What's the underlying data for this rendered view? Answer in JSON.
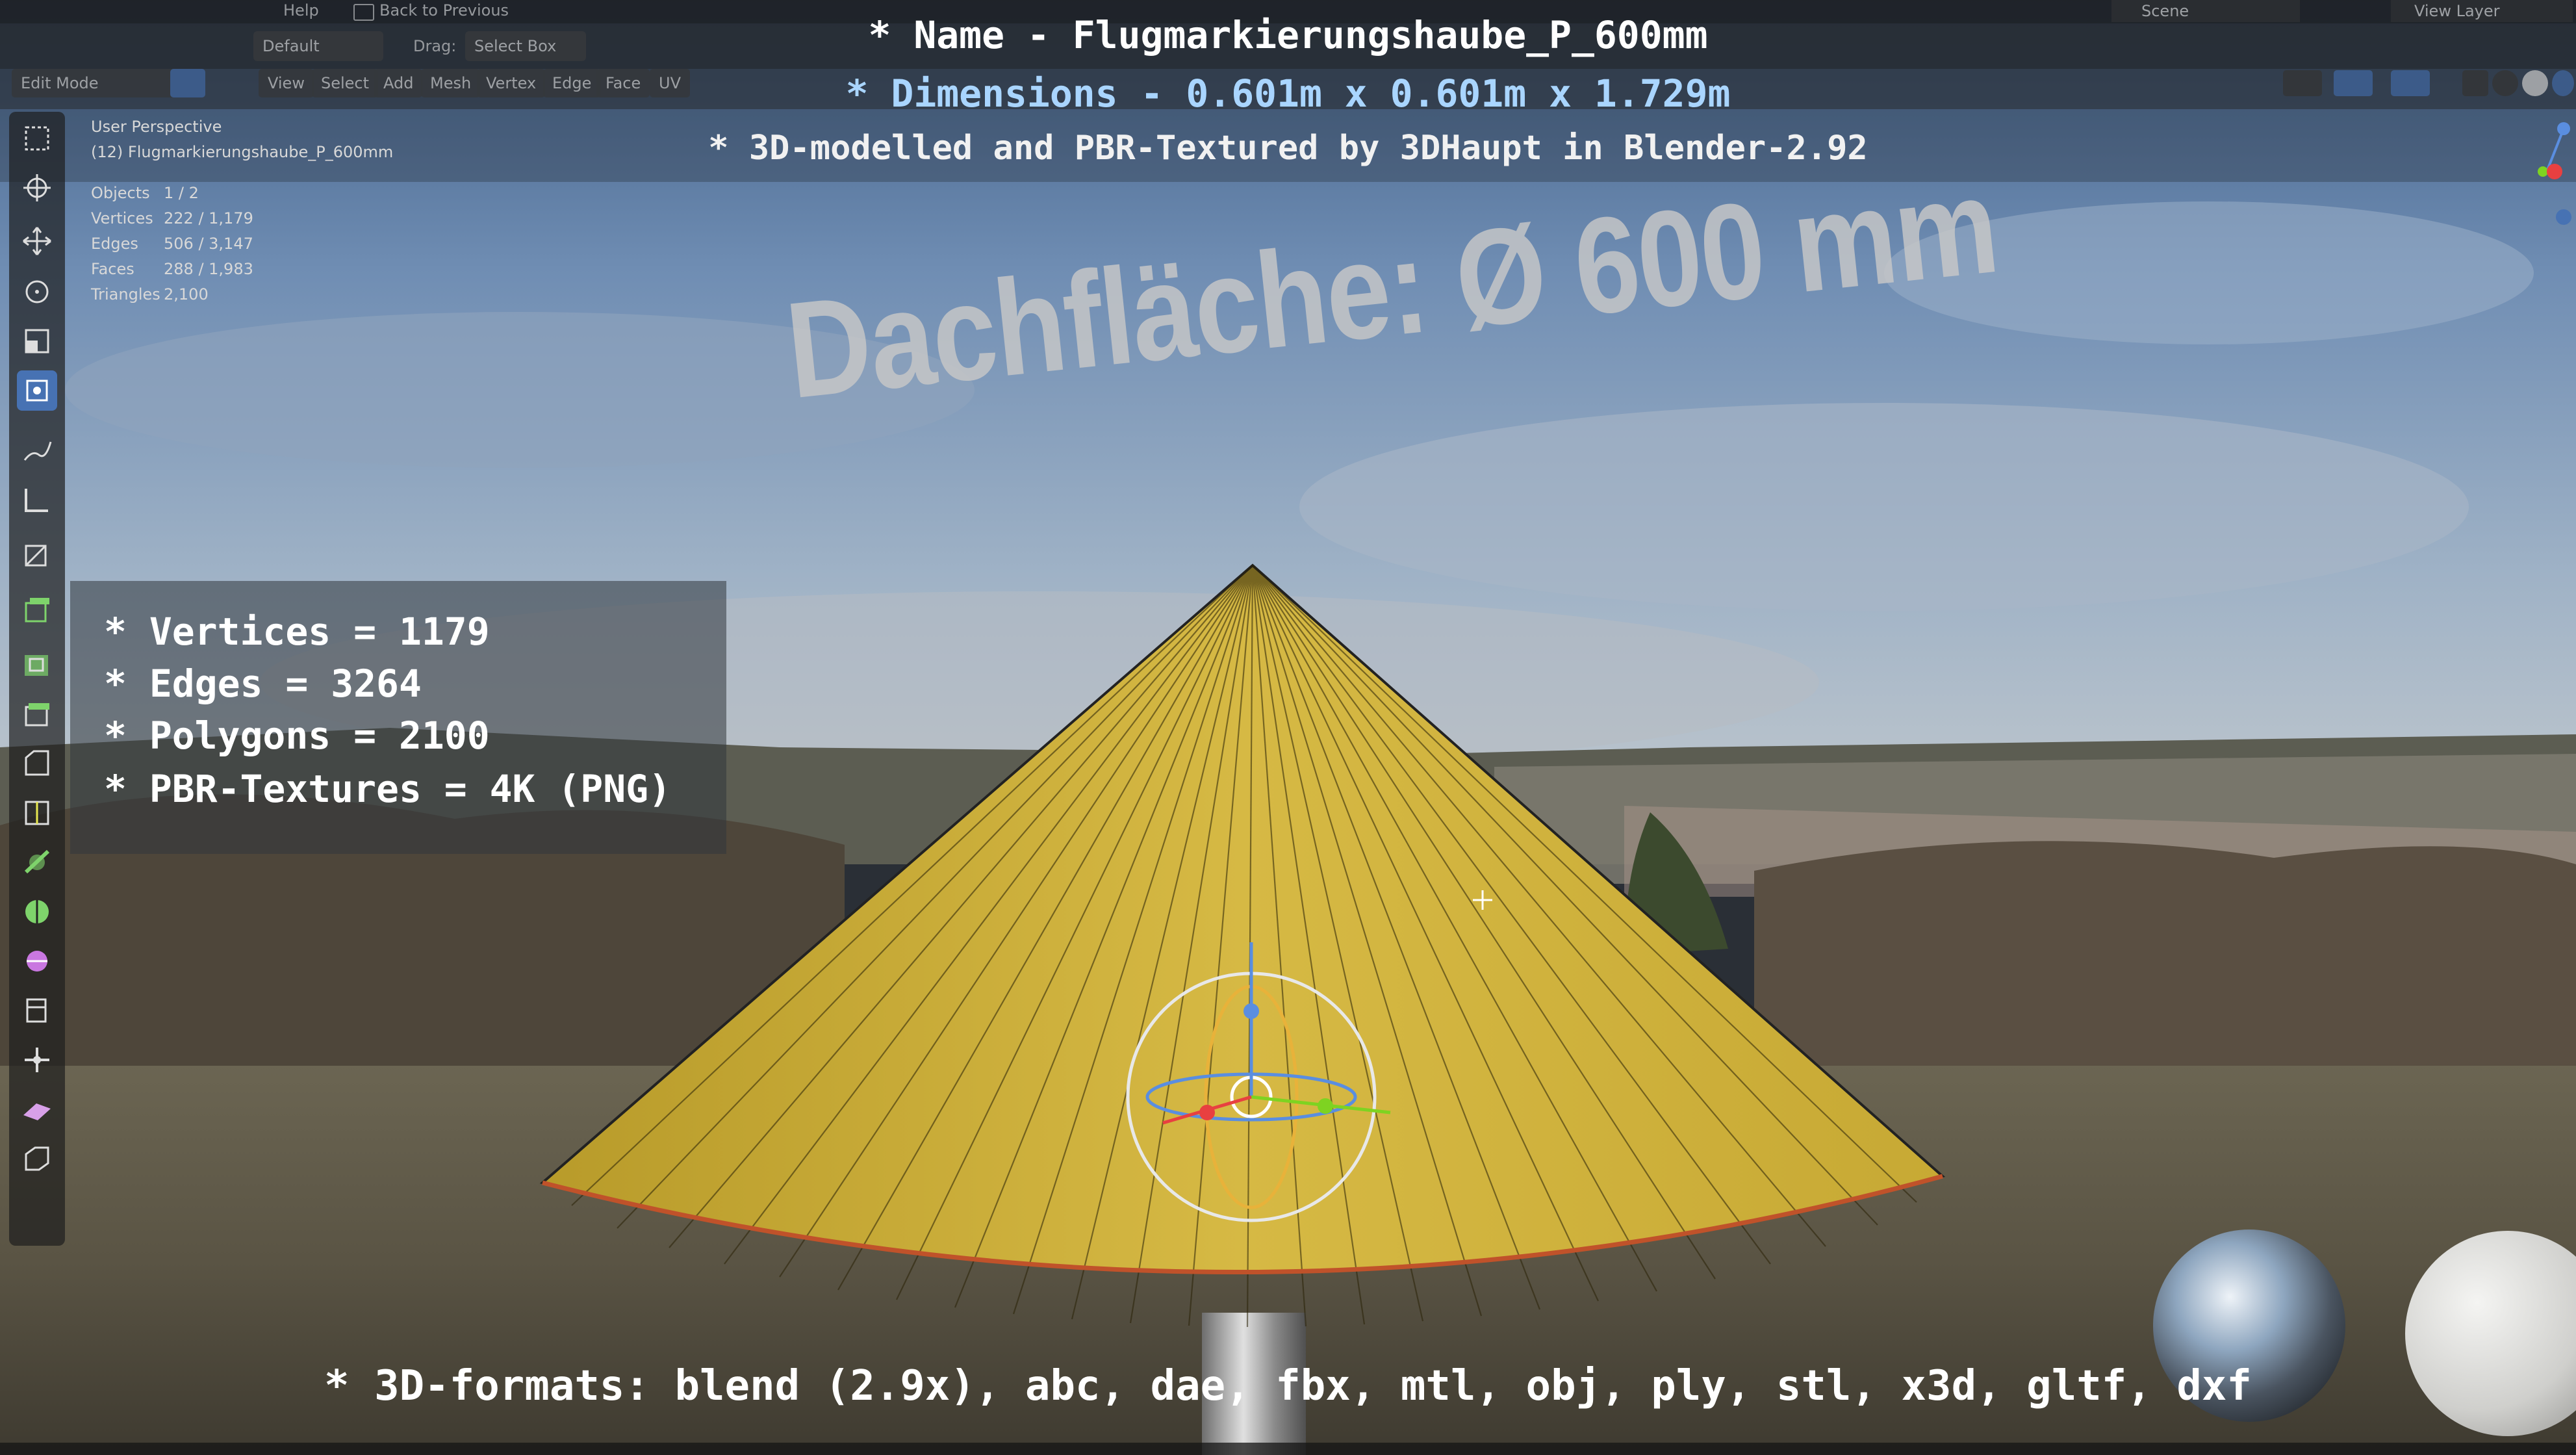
{
  "top_menu": {
    "help": "Help",
    "back_to_previous": "Back to Previous",
    "scene": "Scene",
    "view_layer": "View Layer"
  },
  "header": {
    "mode": "Edit Mode",
    "view": "View",
    "select": "Select",
    "add": "Add",
    "mesh": "Mesh",
    "vertex": "Vertex",
    "edge": "Edge",
    "face": "Face",
    "uv": "UV",
    "orientation_value": "Default",
    "drag_label": "Drag:",
    "drag_value": "Select Box"
  },
  "overlay_title": {
    "name": "* Name - Flugmarkierungshaube_P_600mm",
    "dimensions": "* Dimensions -  0.601m x 0.601m x 1.729m",
    "made_by": "* 3D-modelled and PBR-Textured by 3DHaupt in Blender-2.92"
  },
  "viewport_info": {
    "perspective": "User Perspective",
    "object": "(12) Flugmarkierungshaube_P_600mm"
  },
  "statistics": [
    {
      "label": "Objects",
      "value": "1 / 2"
    },
    {
      "label": "Vertices",
      "value": "222 / 1,179"
    },
    {
      "label": "Edges",
      "value": "506 / 3,147"
    },
    {
      "label": "Faces",
      "value": "288 / 1,983"
    },
    {
      "label": "Triangles",
      "value": "2,100"
    }
  ],
  "stat_panel": [
    "* Vertices = 1179",
    "* Edges = 3264",
    "* Polygons = 2100",
    "* PBR-Textures = 4K (PNG)"
  ],
  "dimension_label": "Dachfläche:  Ø 600 mm",
  "formats": "* 3D-formats: blend (2.9x), abc, dae, fbx, mtl, obj, ply, stl, x3d, gltf, dxf",
  "colors": {
    "cone": "#d3b43c",
    "accent": "#4772b3",
    "sky": "#6f8db3"
  }
}
